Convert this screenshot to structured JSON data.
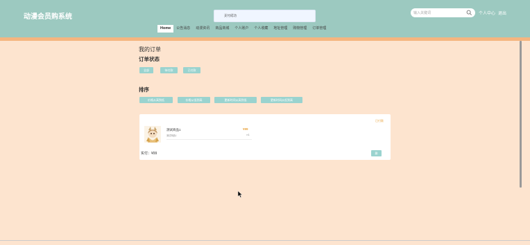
{
  "header": {
    "brand": "动漫会员购系统",
    "toast": "支付成功",
    "search_placeholder": "输入关键词",
    "user_center": "个人中心",
    "logout": "退出"
  },
  "nav": {
    "items": [
      "Home",
      "公告消息",
      "动漫资讯",
      "商品商城",
      "个人账户",
      "个人收藏",
      "地址管理",
      "购物管理",
      "订单管理"
    ]
  },
  "page": {
    "title": "我的订单",
    "status_label": "订单状态",
    "status_buttons": [
      "全部",
      "待付款",
      "已付款"
    ],
    "sort_label": "排序",
    "sort_buttons": [
      "价格从高到低",
      "价格从低到高",
      "更新时间从高到低",
      "更新时间从低到高"
    ]
  },
  "order": {
    "status": "已付款",
    "product_name": "测试商品1",
    "product_sub": "测试商品1",
    "price": "¥99",
    "qty": "×1",
    "paid": "实付：¥99",
    "delete_button": "删"
  },
  "colors": {
    "header": "#9cc9c0",
    "accent_bar": "#f5b57f",
    "background": "#fde4cf",
    "button": "#9ad3cf",
    "price": "#e8a33d"
  },
  "icons": {
    "search": "search-icon",
    "thumbnail": "product-thumbnail"
  }
}
